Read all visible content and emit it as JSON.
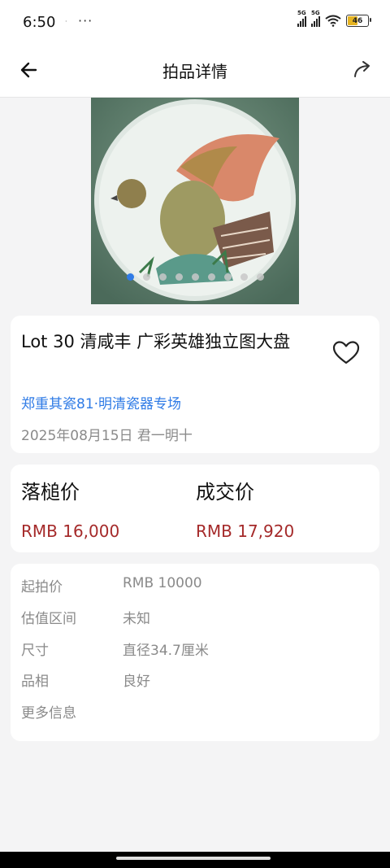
{
  "status_bar": {
    "time": "6:50",
    "indicator": "·",
    "more": "···",
    "signal1": "5G",
    "signal2": "5G",
    "battery": "46"
  },
  "header": {
    "title": "拍品详情",
    "back_icon": "arrow-left-icon",
    "share_icon": "share-icon"
  },
  "gallery": {
    "image_description_icon": "porcelain-plate-image",
    "slide_count": 9,
    "active_slide": 1
  },
  "lot": {
    "title": "Lot 30 清咸丰 广彩英雄独立图大盘",
    "session": "郑重其瓷81·明清瓷器专场",
    "date": "2025年08月15日 君一明十",
    "favorite_icon": "heart-icon"
  },
  "prices": {
    "hammer_label": "落槌价",
    "hammer_value": "RMB 16,000",
    "deal_label": "成交价",
    "deal_value": "RMB 17,920",
    "price_color": "#a52a2a"
  },
  "details": [
    {
      "key": "起拍价",
      "value": "RMB 10000"
    },
    {
      "key": "估值区间",
      "value": "未知"
    },
    {
      "key": "尺寸",
      "value": "直径34.7厘米"
    },
    {
      "key": "品相",
      "value": "良好"
    },
    {
      "key": "更多信息",
      "value": ""
    }
  ],
  "colors": {
    "link": "#2f7be6",
    "background": "#f4f4f5"
  }
}
